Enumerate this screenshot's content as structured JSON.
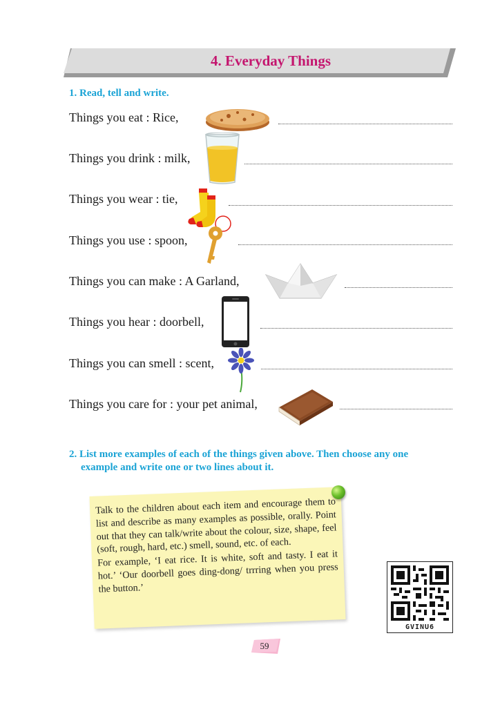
{
  "header": {
    "title": "4. Everyday Things"
  },
  "section1": {
    "heading": "1. Read, tell and write.",
    "rows": [
      {
        "text": "Things you eat : Rice,",
        "icon": "roti-icon"
      },
      {
        "text": "Things you drink : milk,",
        "icon": "juice-glass-icon"
      },
      {
        "text": "Things you wear : tie,",
        "icon": "socks-icon"
      },
      {
        "text": "Things you use : spoon,",
        "icon": "key-icon"
      },
      {
        "text": "Things you can make : A Garland,",
        "icon": "paper-boat-icon"
      },
      {
        "text": "Things you hear : doorbell,",
        "icon": "mobile-phone-icon"
      },
      {
        "text": "Things you can smell : scent,",
        "icon": "flower-icon"
      },
      {
        "text": "Things you care for : your pet animal,",
        "icon": "book-icon"
      }
    ]
  },
  "section2": {
    "heading_line1": "2. List more examples of each of the things given above. Then choose any one",
    "heading_line2": "example and write one or two lines about it."
  },
  "note": {
    "paragraph1": "Talk to the children about each item and encourage them to list and describe as many examples as possible, orally. Point out that they can talk/write about the colour, size, shape, feel (soft, rough, hard, etc.) smell, sound, etc. of each.",
    "paragraph2": "For example, ‘I eat rice. It is white, soft and tasty. I eat it hot.’ ‘Our doorbell goes ding-dong/ trrring when you press the button.’"
  },
  "qr": {
    "code": "GVINU6"
  },
  "footer": {
    "page_number": "59"
  },
  "colors": {
    "title": "#c4166f",
    "heading": "#1aa3d5",
    "note_bg": "#fbf6b8",
    "banner": "#dcdcdc"
  }
}
